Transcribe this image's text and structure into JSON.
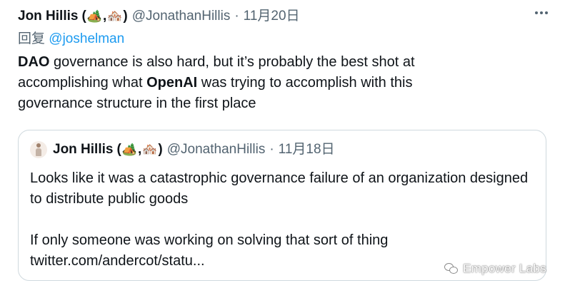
{
  "tweet": {
    "author_name": "Jon Hillis",
    "author_emoji_open": "(",
    "author_emoji_1": "🏕️",
    "author_emoji_sep": ",",
    "author_emoji_2": "🏘️",
    "author_emoji_close": ")",
    "handle": "@JonathanHillis",
    "separator": "·",
    "date": "11月20日",
    "more_icon": "more-horizontal-icon",
    "reply_prefix": "回复",
    "reply_to": "@joshelman",
    "body": {
      "seg1": "DAO",
      "seg2": " governance is also hard, but it’s probably the best shot at accomplishing what ",
      "seg3": "OpenAI",
      "seg4": " was trying to accomplish with this governance structure in the first place"
    }
  },
  "quote": {
    "author_name": "Jon Hillis",
    "author_emoji_open": "(",
    "author_emoji_1": "🏕️",
    "author_emoji_sep": ",",
    "author_emoji_2": "🏘️",
    "author_emoji_close": ")",
    "handle": "@JonathanHillis",
    "separator": "·",
    "date": "11月18日",
    "text": "Looks like it was a catastrophic governance failure of an organization designed to distribute public goods\n\nIf only someone was working on solving that sort of thing",
    "link": "twitter.com/andercot/statu..."
  },
  "watermark": {
    "label": "Empower Labs",
    "icon": "wechat-icon"
  },
  "colors": {
    "text": "#0f1419",
    "secondary": "#536471",
    "link": "#1d9bf0",
    "border": "#cfd9de"
  }
}
